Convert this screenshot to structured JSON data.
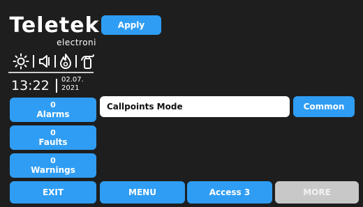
{
  "logo": {
    "brand": "Teletek",
    "sub": "electroni"
  },
  "status_icons": [
    "sun-icon",
    "speaker-icon",
    "fire-icon",
    "extinguisher-icon"
  ],
  "clock": {
    "time": "13:22",
    "date_line1": "02.07.",
    "date_line2": "2021"
  },
  "toolbar": {
    "apply_label": "Apply"
  },
  "counters": {
    "alarms": {
      "count": "0",
      "label": "Alarms"
    },
    "faults": {
      "count": "0",
      "label": "Faults"
    },
    "warnings": {
      "count": "0",
      "label": "Warnings"
    }
  },
  "mode": {
    "value": "Callpoints Mode",
    "option_label": "Common"
  },
  "bottom": {
    "exit_label": "EXIT",
    "menu_label": "MENU",
    "access_label": "Access 3",
    "more_label": "MORE"
  },
  "colors": {
    "button": "#2f9df4",
    "background": "#1e1e1e",
    "disabled": "#c8c8c8"
  }
}
